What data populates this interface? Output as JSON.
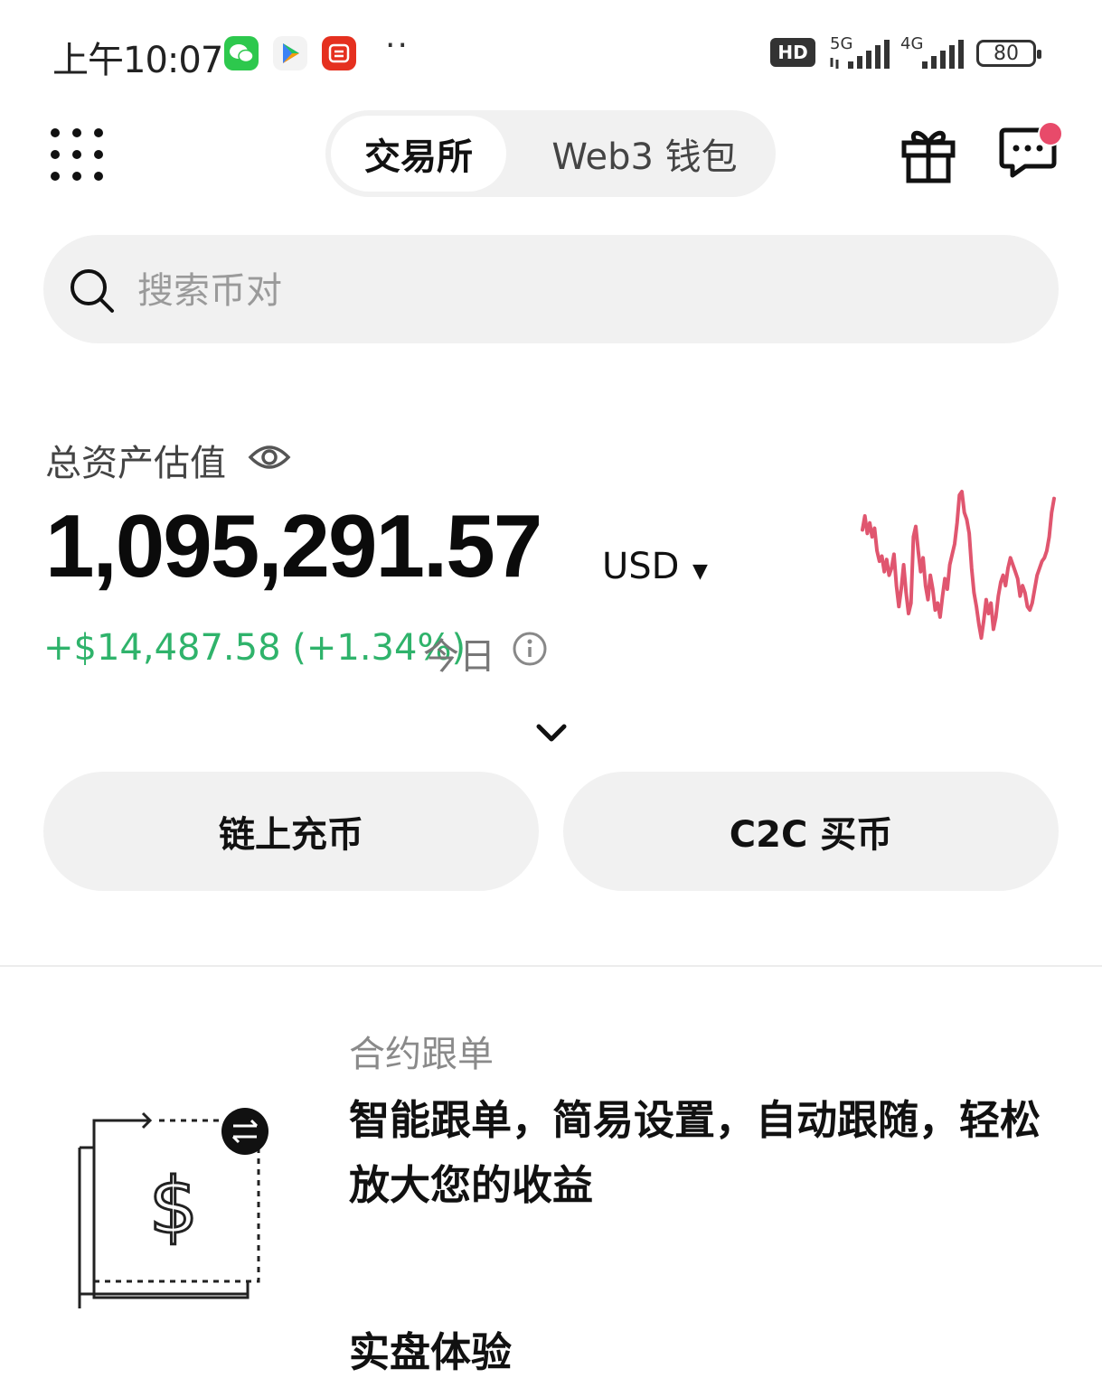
{
  "status_bar": {
    "time": "上午10:07",
    "apps": [
      {
        "name": "wechat-icon",
        "color": "#2dc84d"
      },
      {
        "name": "play-store-icon",
        "color": "#f5f5f5"
      },
      {
        "name": "taobao-icon",
        "color": "#e5301f"
      }
    ],
    "more_dots": "··",
    "hd_label": "HD",
    "network_5g": "5G",
    "network_4g": "4G",
    "battery": "80"
  },
  "header": {
    "tabs": [
      {
        "label": "交易所",
        "active": true
      },
      {
        "label": "Web3 钱包",
        "active": false
      }
    ],
    "has_message_badge": true
  },
  "search": {
    "placeholder": "搜索币对"
  },
  "assets": {
    "label": "总资产估值",
    "value": "1,095,291.57",
    "currency": "USD",
    "pnl": "+$14,487.58 (+1.34%)",
    "pnl_period": "今日",
    "pnl_color": "#2fb36b",
    "trend_color": "#e0566f",
    "sparkline_values": [
      62,
      70,
      60,
      66,
      58,
      63,
      50,
      44,
      47,
      38,
      45,
      36,
      40,
      48,
      30,
      18,
      28,
      42,
      26,
      14,
      20,
      58,
      64,
      50,
      38,
      46,
      30,
      22,
      36,
      28,
      16,
      20,
      12,
      24,
      34,
      28,
      42,
      48,
      54,
      66,
      82,
      84,
      72,
      68,
      60,
      40,
      26,
      18,
      8,
      0,
      10,
      22,
      14,
      20,
      5,
      12,
      24,
      32,
      36,
      30,
      40,
      46,
      42,
      38,
      34,
      24,
      30,
      26,
      18,
      16,
      20,
      28,
      36,
      40,
      44,
      46,
      50,
      58,
      72,
      80
    ]
  },
  "actions": {
    "deposit": "链上充币",
    "c2c": "C2C 买币"
  },
  "promo": {
    "tag": "合约跟单",
    "description": "智能跟单，简易设置，自动跟随，轻松放大您的收益",
    "next_title": "实盘体验"
  }
}
